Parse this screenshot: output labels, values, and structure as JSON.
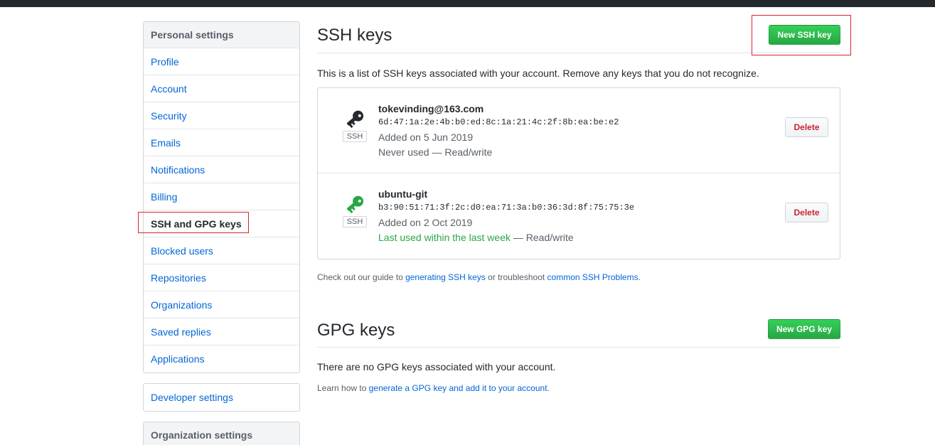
{
  "sidebar": {
    "personal_heading": "Personal settings",
    "items": [
      {
        "label": "Profile"
      },
      {
        "label": "Account"
      },
      {
        "label": "Security"
      },
      {
        "label": "Emails"
      },
      {
        "label": "Notifications"
      },
      {
        "label": "Billing"
      },
      {
        "label": "SSH and GPG keys",
        "selected": true
      },
      {
        "label": "Blocked users"
      },
      {
        "label": "Repositories"
      },
      {
        "label": "Organizations"
      },
      {
        "label": "Saved replies"
      },
      {
        "label": "Applications"
      }
    ],
    "developer_settings": "Developer settings",
    "organization_heading": "Organization settings"
  },
  "ssh": {
    "title": "SSH keys",
    "new_button": "New SSH key",
    "intro": "This is a list of SSH keys associated with your account. Remove any keys that you do not recognize.",
    "keys": [
      {
        "title": "tokevinding@163.com",
        "fingerprint": "6d:47:1a:2e:4b:b0:ed:8c:1a:21:4c:2f:8b:ea:be:e2",
        "added": "Added on 5 Jun 2019",
        "usage": "Never used",
        "usage_suffix": " — Read/write",
        "badge": "SSH",
        "delete_label": "Delete",
        "icon_color": "#24292e"
      },
      {
        "title": "ubuntu-git",
        "fingerprint": "b3:90:51:71:3f:2c:d0:ea:71:3a:b0:36:3d:8f:75:75:3e",
        "added": "Added on 2 Oct 2019",
        "usage": "Last used within the last week",
        "usage_suffix": " — Read/write",
        "badge": "SSH",
        "delete_label": "Delete",
        "icon_color": "#28a745"
      }
    ],
    "note_prefix": "Check out our guide to ",
    "note_link1": "generating SSH keys",
    "note_middle": " or troubleshoot ",
    "note_link2": "common SSH Problems",
    "note_suffix": "."
  },
  "gpg": {
    "title": "GPG keys",
    "new_button": "New GPG key",
    "empty": "There are no GPG keys associated with your account.",
    "learn_prefix": "Learn how to ",
    "learn_link": "generate a GPG key and add it to your account",
    "learn_suffix": "."
  },
  "colors": {
    "link": "#0366d6",
    "primary": "#28a745",
    "danger": "#cb2431",
    "annotation": "#e0202a"
  }
}
